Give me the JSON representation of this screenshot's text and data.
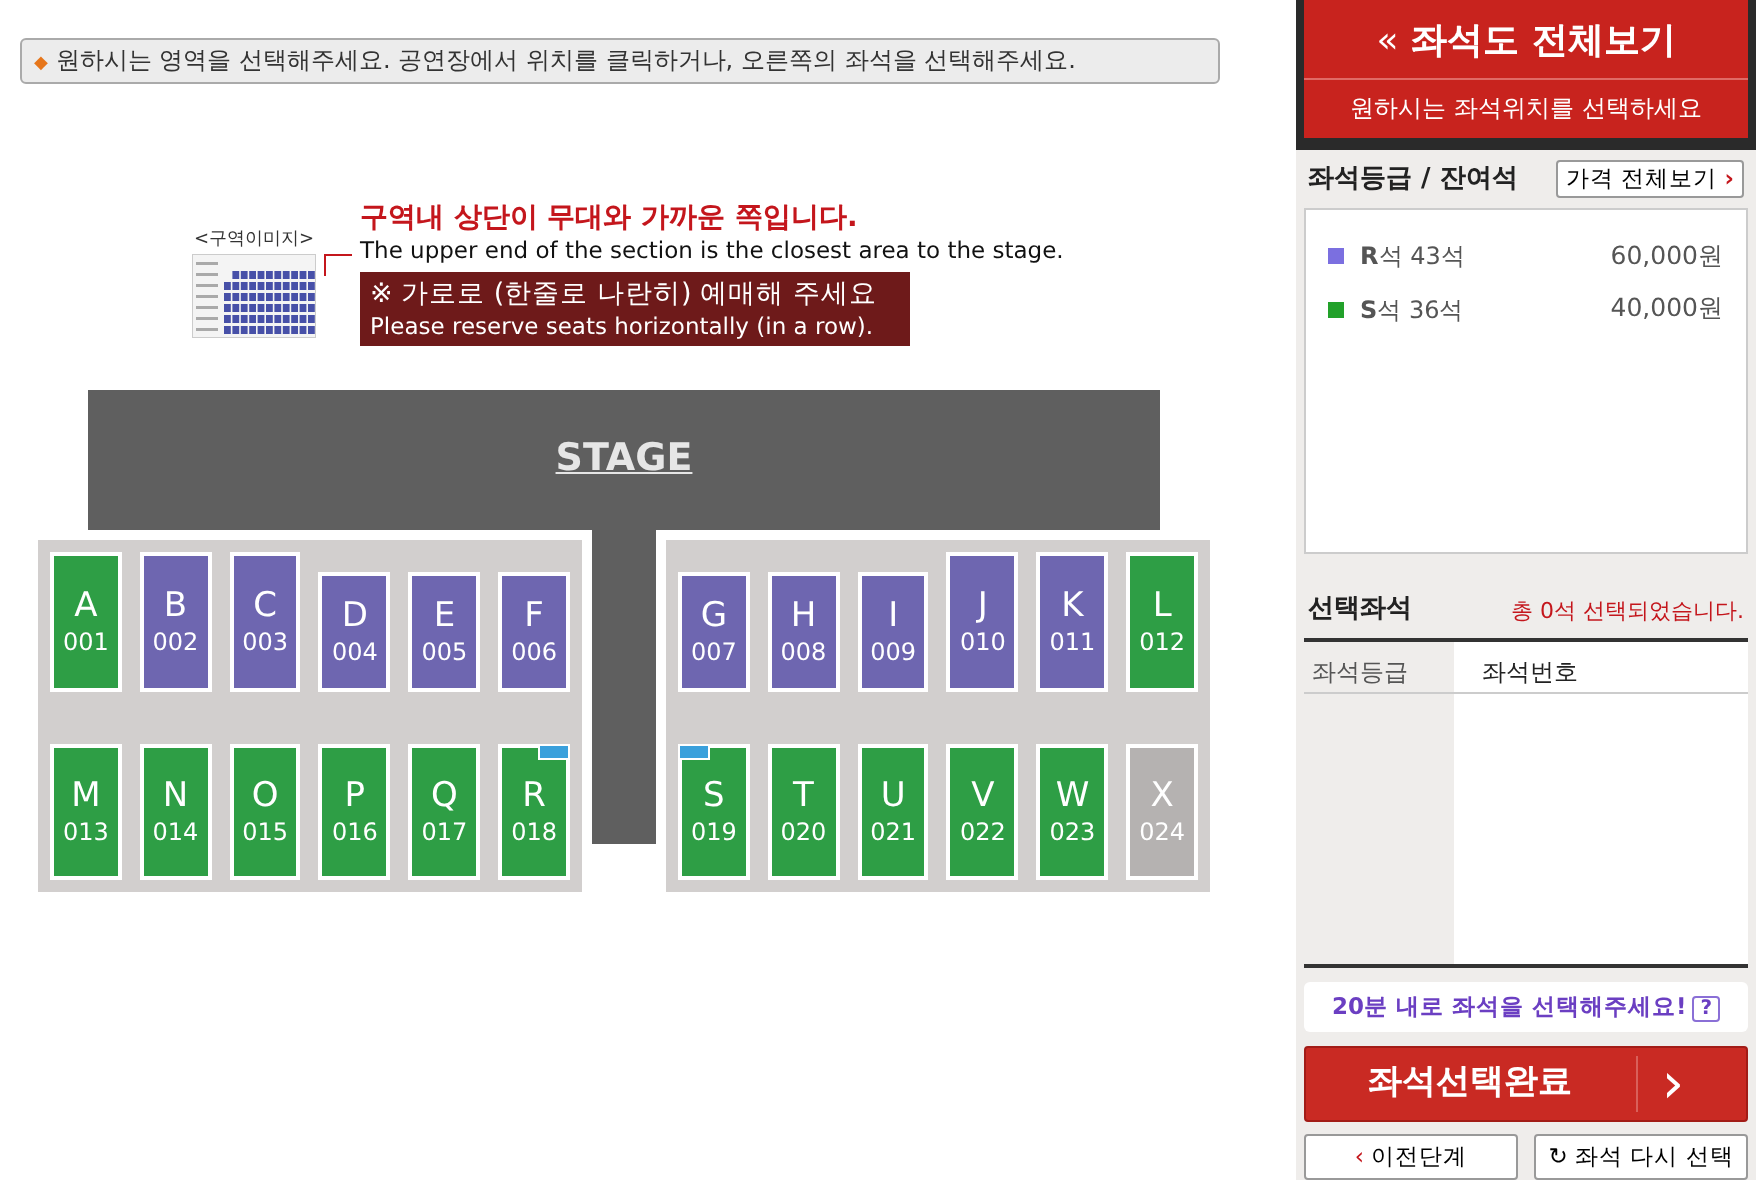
{
  "notice": {
    "icon": "◆",
    "text": "원하시는 영역을 선택해주세요. 공연장에서 위치를 클릭하거나, 오른쪽의 좌석을 선택해주세요."
  },
  "guide": {
    "image_label": "<구역이미지>",
    "title_ko": "구역내 상단이 무대와 가까운 쪽입니다.",
    "title_en": "The upper end of the section is the closest area to the stage.",
    "warning_ko": "※ 가로로 (한줄로 나란히) 예매해 주세요",
    "warning_en": "Please reserve seats horizontally (in a row)."
  },
  "stage": "STAGE",
  "sections": [
    {
      "letter": "A",
      "number": "001",
      "color": "#2e9e45",
      "tall": true,
      "marked": false
    },
    {
      "letter": "B",
      "number": "002",
      "color": "#6e66b0",
      "tall": true,
      "marked": false
    },
    {
      "letter": "C",
      "number": "003",
      "color": "#6e66b0",
      "tall": true,
      "marked": false
    },
    {
      "letter": "D",
      "number": "004",
      "color": "#6e66b0",
      "tall": false,
      "marked": false
    },
    {
      "letter": "E",
      "number": "005",
      "color": "#6e66b0",
      "tall": false,
      "marked": false
    },
    {
      "letter": "F",
      "number": "006",
      "color": "#6e66b0",
      "tall": false,
      "marked": false
    },
    {
      "letter": "G",
      "number": "007",
      "color": "#6e66b0",
      "tall": false,
      "marked": false
    },
    {
      "letter": "H",
      "number": "008",
      "color": "#6e66b0",
      "tall": false,
      "marked": false
    },
    {
      "letter": "I",
      "number": "009",
      "color": "#6e66b0",
      "tall": false,
      "marked": false
    },
    {
      "letter": "J",
      "number": "010",
      "color": "#6e66b0",
      "tall": true,
      "marked": false
    },
    {
      "letter": "K",
      "number": "011",
      "color": "#6e66b0",
      "tall": true,
      "marked": false
    },
    {
      "letter": "L",
      "number": "012",
      "color": "#2e9e45",
      "tall": true,
      "marked": false
    },
    {
      "letter": "M",
      "number": "013",
      "color": "#2e9e45",
      "marked": false
    },
    {
      "letter": "N",
      "number": "014",
      "color": "#2e9e45",
      "marked": false
    },
    {
      "letter": "O",
      "number": "015",
      "color": "#2e9e45",
      "marked": false
    },
    {
      "letter": "P",
      "number": "016",
      "color": "#2e9e45",
      "marked": false
    },
    {
      "letter": "Q",
      "number": "017",
      "color": "#2e9e45",
      "marked": false
    },
    {
      "letter": "R",
      "number": "018",
      "color": "#2e9e45",
      "marked": true
    },
    {
      "letter": "S",
      "number": "019",
      "color": "#2e9e45",
      "marked": true
    },
    {
      "letter": "T",
      "number": "020",
      "color": "#2e9e45",
      "marked": false
    },
    {
      "letter": "U",
      "number": "021",
      "color": "#2e9e45",
      "marked": false
    },
    {
      "letter": "V",
      "number": "022",
      "color": "#2e9e45",
      "marked": false
    },
    {
      "letter": "W",
      "number": "023",
      "color": "#2e9e45",
      "marked": false
    },
    {
      "letter": "X",
      "number": "024",
      "color": "#b5b2b1",
      "marked": false
    }
  ],
  "sidebar": {
    "title_icon": "«",
    "title": "좌석도 전체보기",
    "price_icon": "›",
    "complete_icon": "›",
    "prev_icon": "‹",
    "reset_icon": "↻",
    "subtitle": "원하시는 좌석위치를 선택하세요",
    "grades_heading": "좌석등급 / 잔여석",
    "price_button": "가격 전체보기",
    "grades": [
      {
        "name": "**R**석 43석",
        "price": "60,000원",
        "color": "#7b6fe0"
      },
      {
        "name": "**S**석 36석",
        "price": "40,000원",
        "color": "#22a12a"
      }
    ],
    "selected_heading": "선택좌석",
    "selected_count": "총 0석 선택되었습니다.",
    "columns": [
      "좌석등급",
      "좌석번호"
    ],
    "timer_note": "20분 내로 좌석을 선택해주세요!",
    "help": "?",
    "complete_button": "좌석선택완료",
    "prev_button": "이전단계",
    "reset_button": "좌석 다시 선택"
  }
}
